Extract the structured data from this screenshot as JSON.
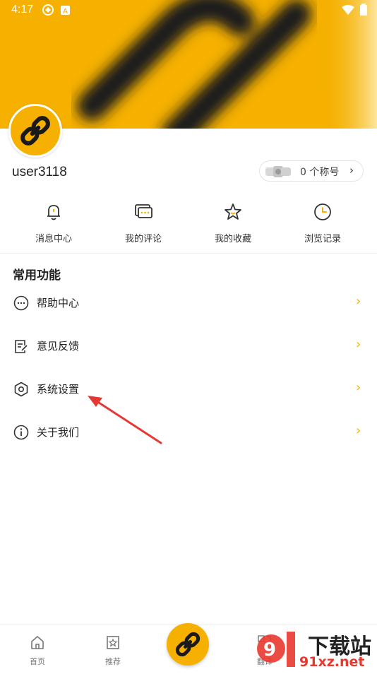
{
  "status_bar": {
    "time": "4:17"
  },
  "profile": {
    "username": "user3118",
    "title_badge": "0 个称号"
  },
  "quick_actions": [
    {
      "label": "消息中心",
      "icon": "bell-icon"
    },
    {
      "label": "我的评论",
      "icon": "comment-icon"
    },
    {
      "label": "我的收藏",
      "icon": "star-icon"
    },
    {
      "label": "浏览记录",
      "icon": "clock-icon"
    }
  ],
  "section": {
    "title": "常用功能"
  },
  "menu": [
    {
      "label": "帮助中心",
      "icon": "more-circle-icon"
    },
    {
      "label": "意见反馈",
      "icon": "edit-note-icon"
    },
    {
      "label": "系统设置",
      "icon": "hexagon-settings-icon"
    },
    {
      "label": "关于我们",
      "icon": "info-icon"
    }
  ],
  "bottom_nav": [
    {
      "label": "首页",
      "icon": "home-icon"
    },
    {
      "label": "推荐",
      "icon": "bookmark-star-icon"
    },
    {
      "label": "翻译",
      "icon": "translate-icon"
    }
  ],
  "watermark": {
    "text": "下载站",
    "domain": "91xz.net"
  },
  "colors": {
    "accent": "#f5b000",
    "text": "#222222",
    "annotation": "#e53935"
  }
}
